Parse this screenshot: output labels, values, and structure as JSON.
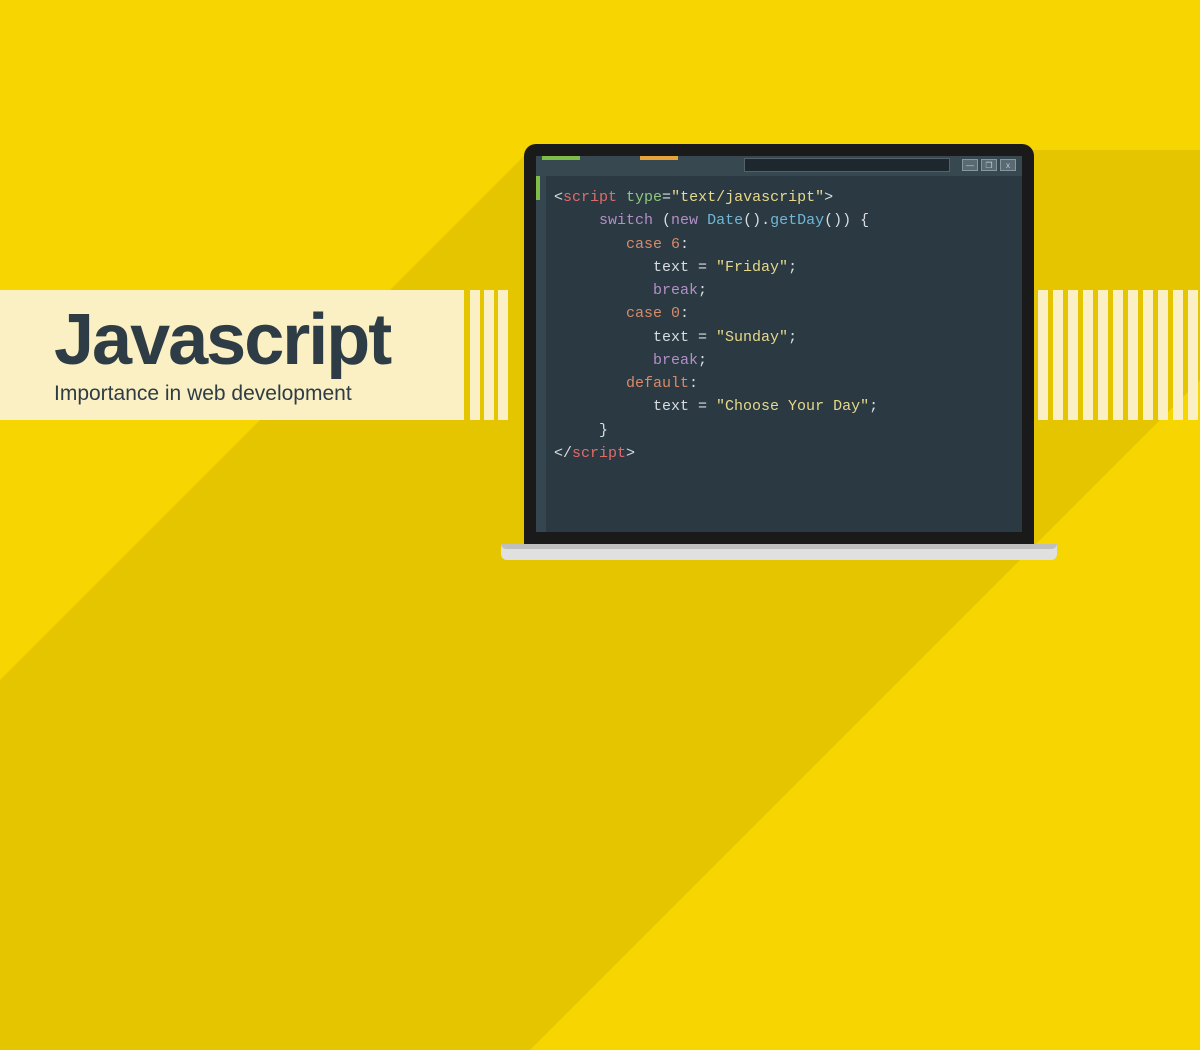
{
  "title": "Javascript",
  "subtitle": "Importance in web development",
  "window_controls": {
    "minimize": "—",
    "maximize": "❐",
    "close": "x"
  },
  "code": {
    "l1_open": "<",
    "l1_tag": "script",
    "l1_attr": " type",
    "l1_eq": "=",
    "l1_str": "\"text/javascript\"",
    "l1_close": ">",
    "l2_kw": "switch",
    "l2_p1": " (",
    "l2_new": "new",
    "l2_sp": " ",
    "l2_date": "Date",
    "l2_p2": "().",
    "l2_gd": "getDay",
    "l2_p3": "()) {",
    "l3_case": "case",
    "l3_num": " 6",
    "l3_c": ":",
    "l4_txt": "text = ",
    "l4_str": "\"Friday\"",
    "l4_sc": ";",
    "l5_br": "break",
    "l5_sc": ";",
    "l6_case": "case",
    "l6_num": " 0",
    "l6_c": ":",
    "l7_txt": "text = ",
    "l7_str": "\"Sunday\"",
    "l7_sc": ";",
    "l8_br": "break",
    "l8_sc": ";",
    "l9_def": "default",
    "l9_c": ":",
    "l10_txt": "text = ",
    "l10_str": "\"Choose Your Day\"",
    "l10_sc": ";",
    "l11_cb": "}",
    "l12_open": "</",
    "l12_tag": "script",
    "l12_close": ">"
  }
}
